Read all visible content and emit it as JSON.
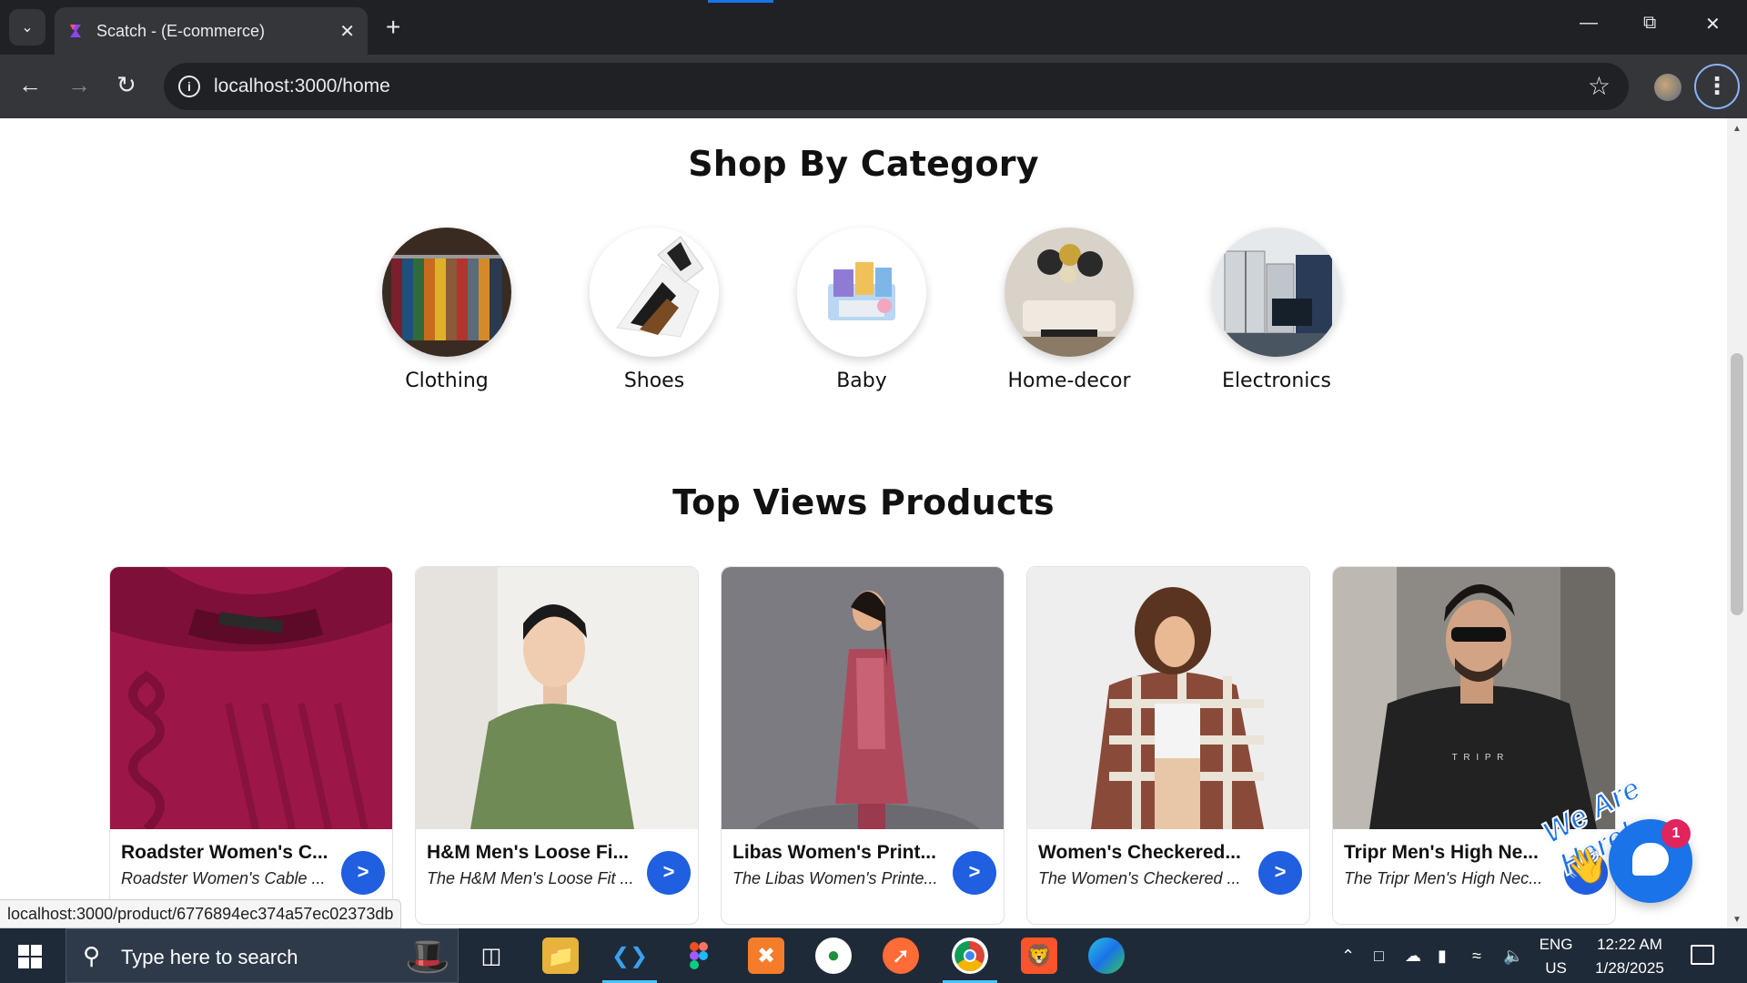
{
  "browser": {
    "tab_title": "Scatch - (E-commerce)",
    "url": "localhost:3000/home",
    "status_url": "localhost:3000/product/6776894ec374a57ec02373db"
  },
  "page": {
    "category_section_title": "Shop By Category",
    "categories": [
      {
        "label": "Clothing"
      },
      {
        "label": "Shoes"
      },
      {
        "label": "Baby"
      },
      {
        "label": "Home-decor"
      },
      {
        "label": "Electronics"
      }
    ],
    "products_section_title": "Top Views Products",
    "products": [
      {
        "title": "Roadster Women's C...",
        "desc": "Roadster Women's Cable ...",
        "button": ">"
      },
      {
        "title": "H&M Men's Loose Fi...",
        "desc": "The H&M Men's Loose Fit ...",
        "button": ">"
      },
      {
        "title": "Libas Women's Print...",
        "desc": "The Libas Women's Printe...",
        "button": ">"
      },
      {
        "title": "Women's Checkered...",
        "desc": "The Women's Checkered ...",
        "button": ">"
      },
      {
        "title": "Tripr Men's High Ne...",
        "desc": "The Tripr Men's High Nec...",
        "button": ">"
      }
    ],
    "product_brand_print": "T R I P R"
  },
  "chat_widget": {
    "banner": "We Are Here!",
    "badge_count": "1"
  },
  "taskbar": {
    "search_placeholder": "Type here to search",
    "language_line1": "ENG",
    "language_line2": "US",
    "time": "12:22 AM",
    "date": "1/28/2025"
  },
  "colors": {
    "accent_button": "#1f5fe0",
    "chrome_dark": "#202124",
    "taskbar": "#1f2a38"
  },
  "icons": [
    "chevron-down-icon",
    "close-icon",
    "plus-icon",
    "back-arrow-icon",
    "forward-arrow-icon",
    "reload-icon",
    "info-icon",
    "star-icon",
    "kebab-menu-icon",
    "windows-start-icon",
    "search-icon",
    "chat-icon",
    "wave-hand-icon"
  ]
}
